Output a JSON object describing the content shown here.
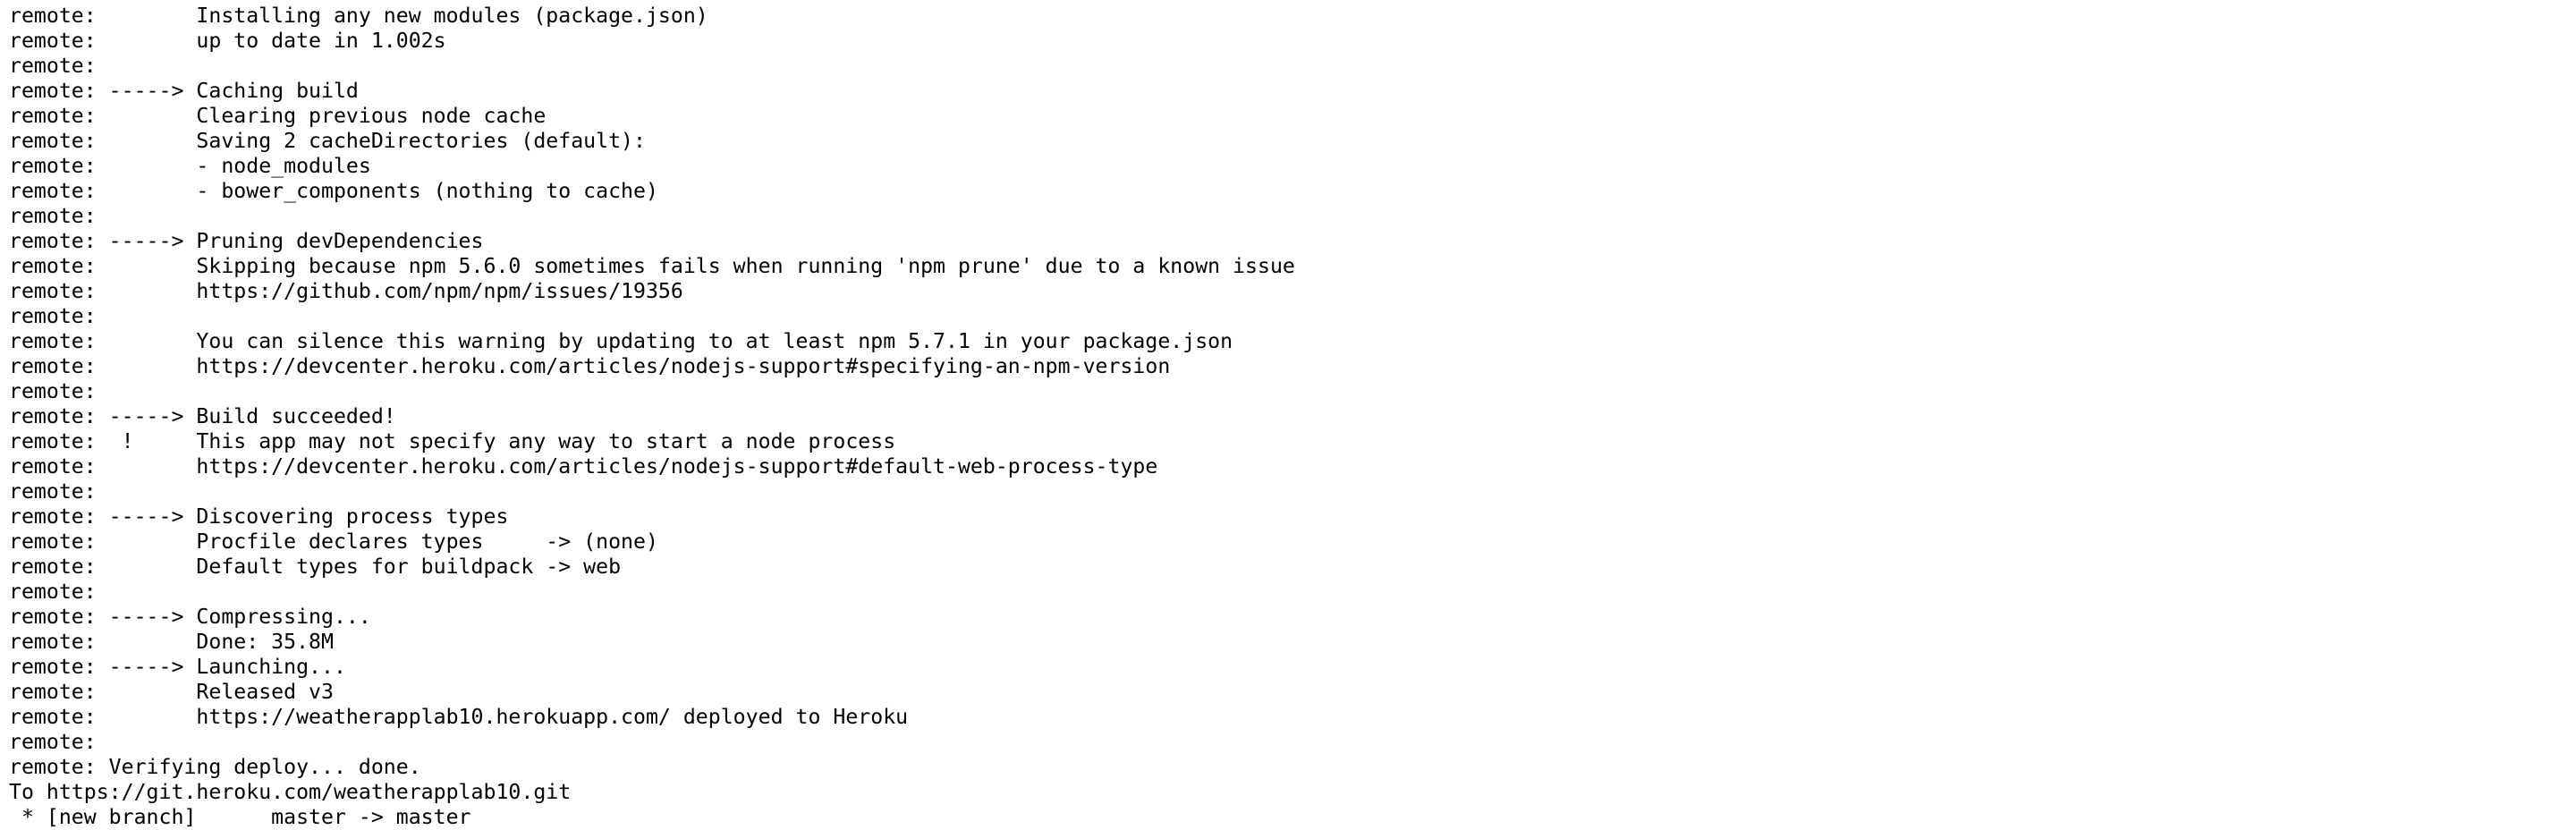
{
  "terminal": {
    "lines": [
      "remote:        Installing any new modules (package.json)",
      "remote:        up to date in 1.002s",
      "remote:",
      "remote: -----> Caching build",
      "remote:        Clearing previous node cache",
      "remote:        Saving 2 cacheDirectories (default):",
      "remote:        - node_modules",
      "remote:        - bower_components (nothing to cache)",
      "remote:",
      "remote: -----> Pruning devDependencies",
      "remote:        Skipping because npm 5.6.0 sometimes fails when running 'npm prune' due to a known issue",
      "remote:        https://github.com/npm/npm/issues/19356",
      "remote:",
      "remote:        You can silence this warning by updating to at least npm 5.7.1 in your package.json",
      "remote:        https://devcenter.heroku.com/articles/nodejs-support#specifying-an-npm-version",
      "remote:",
      "remote: -----> Build succeeded!",
      "remote:  !     This app may not specify any way to start a node process",
      "remote:        https://devcenter.heroku.com/articles/nodejs-support#default-web-process-type",
      "remote:",
      "remote: -----> Discovering process types",
      "remote:        Procfile declares types     -> (none)",
      "remote:        Default types for buildpack -> web",
      "remote:",
      "remote: -----> Compressing...",
      "remote:        Done: 35.8M",
      "remote: -----> Launching...",
      "remote:        Released v3",
      "remote:        https://weatherapplab10.herokuapp.com/ deployed to Heroku",
      "remote:",
      "remote: Verifying deploy... done.",
      "To https://git.heroku.com/weatherapplab10.git",
      " * [new branch]      master -> master"
    ]
  }
}
